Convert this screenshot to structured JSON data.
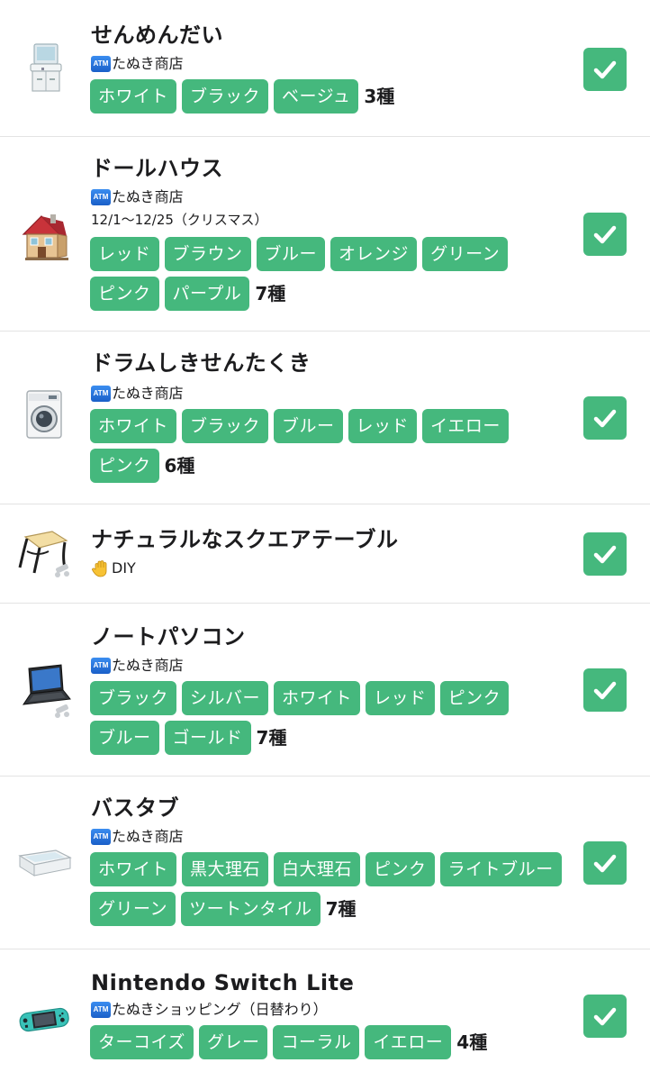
{
  "items": [
    {
      "name": "せんめんだい",
      "source": "たぬき商店",
      "colors": [
        "ホワイト",
        "ブラック",
        "ベージュ"
      ],
      "count": "3種",
      "checked": true
    },
    {
      "name": "ドールハウス",
      "source": "たぬき商店",
      "event": "12/1〜12/25（クリスマス）",
      "colors": [
        "レッド",
        "ブラウン",
        "ブルー",
        "オレンジ",
        "グリーン",
        "ピンク",
        "パープル"
      ],
      "count": "7種",
      "checked": true
    },
    {
      "name": "ドラムしきせんたくき",
      "source": "たぬき商店",
      "colors": [
        "ホワイト",
        "ブラック",
        "ブルー",
        "レッド",
        "イエロー",
        "ピンク"
      ],
      "count": "6種",
      "checked": true
    },
    {
      "name": "ナチュラルなスクエアテーブル",
      "source": "DIY",
      "checked": true
    },
    {
      "name": "ノートパソコン",
      "source": "たぬき商店",
      "colors": [
        "ブラック",
        "シルバー",
        "ホワイト",
        "レッド",
        "ピンク",
        "ブルー",
        "ゴールド"
      ],
      "count": "7種",
      "checked": true
    },
    {
      "name": "バスタブ",
      "source": "たぬき商店",
      "colors": [
        "ホワイト",
        "黒大理石",
        "白大理石",
        "ピンク",
        "ライトブルー",
        "グリーン",
        "ツートンタイル"
      ],
      "count": "7種",
      "checked": true
    },
    {
      "name": "Nintendo Switch Lite",
      "source": "たぬきショッピング（日替わり）",
      "colors": [
        "ターコイズ",
        "グレー",
        "コーラル",
        "イエロー"
      ],
      "count": "4種",
      "checked": true
    }
  ],
  "badges": {
    "atm": "ATM"
  },
  "icons": {
    "check": "checkmark-icon",
    "shop": "atm-icon",
    "diy": "raised-hand-icon"
  },
  "colors": {
    "accent": "#45b87d",
    "divider": "#e3e3e3"
  }
}
